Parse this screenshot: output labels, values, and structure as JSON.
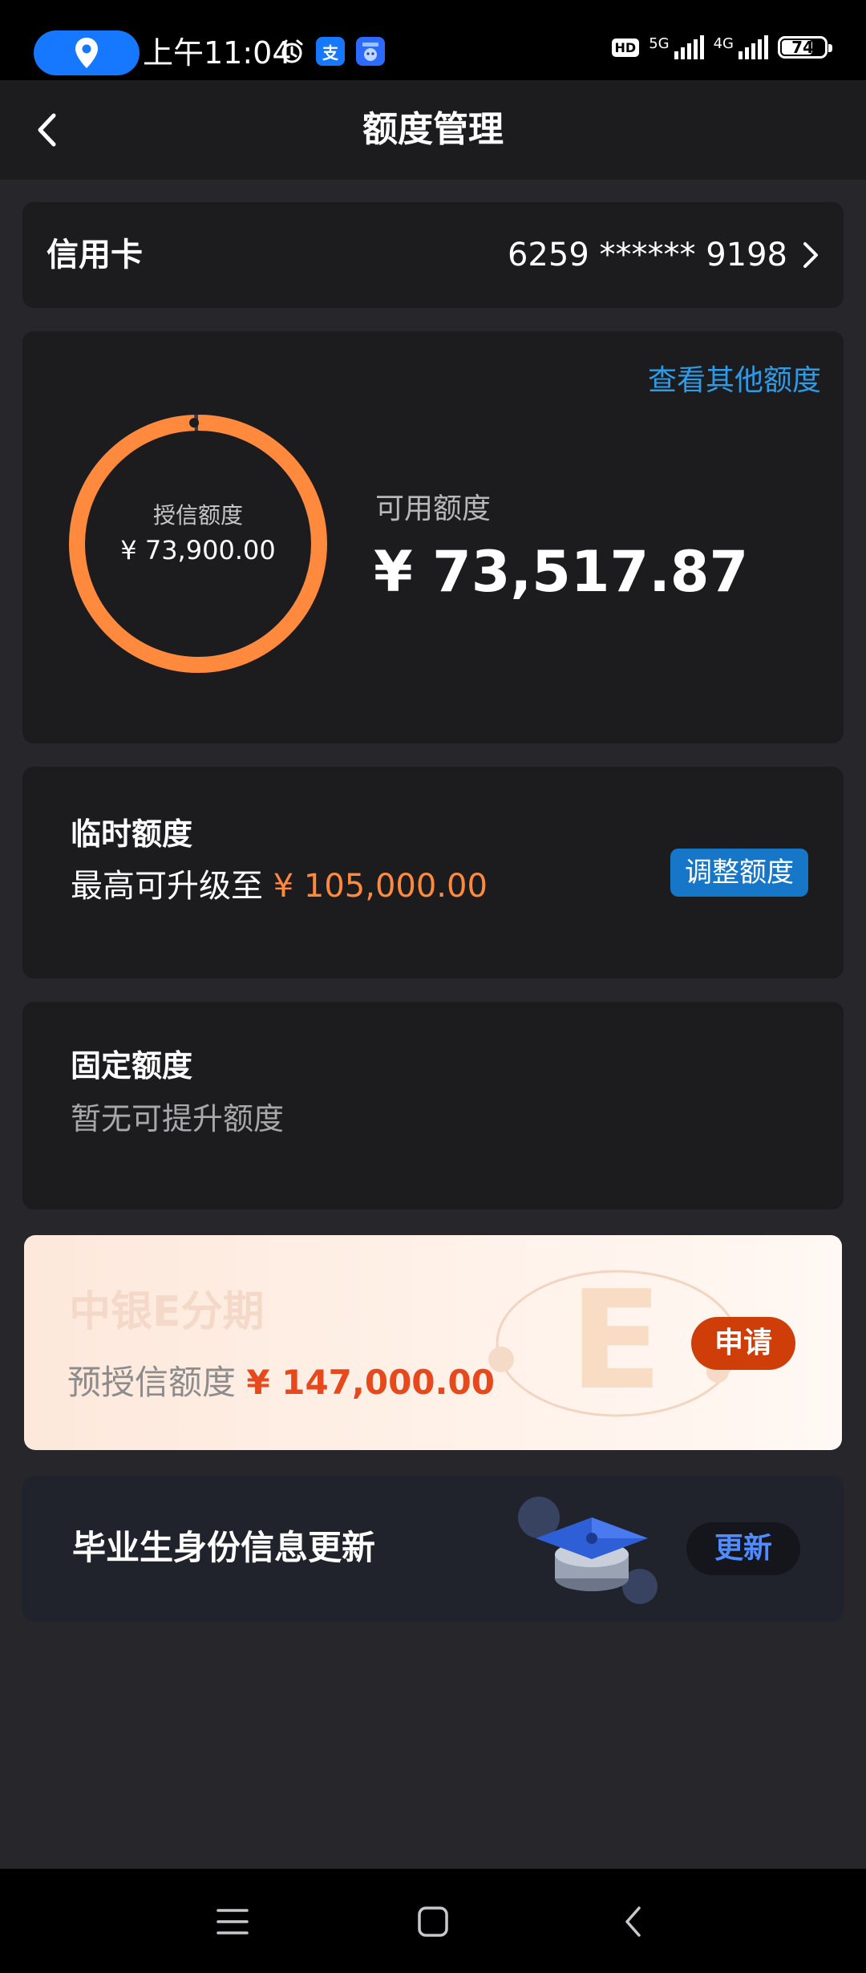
{
  "status_bar": {
    "time": "上午11:04",
    "alipay_icon_text": "支",
    "network_1": "5G",
    "network_2": "4G",
    "hd": "HD",
    "battery_level": 74,
    "battery_text": "74"
  },
  "header": {
    "title": "额度管理"
  },
  "account": {
    "label": "信用卡",
    "card_number": "6259 ****** 9198"
  },
  "credit": {
    "view_other_link": "查看其他额度",
    "total_label": "授信额度",
    "total_value": "¥ 73,900.00",
    "available_label": "可用额度",
    "available_value": "¥ 73,517.87",
    "available_fraction": 0.9948
  },
  "temporary": {
    "title": "临时额度",
    "subtitle_prefix": "最高可升级至",
    "subtitle_amount": "¥ 105,000.00",
    "button_label": "调整额度"
  },
  "fixed": {
    "title": "固定额度",
    "subtitle": "暂无可提升额度"
  },
  "promo": {
    "title": "中银E分期",
    "subtitle_prefix": "预授信额度",
    "subtitle_amount": "¥ 147,000.00",
    "button_label": "申请"
  },
  "graduate": {
    "title": "毕业生身份信息更新",
    "button_label": "更新"
  },
  "colors": {
    "ring": "#ff8a3d",
    "link": "#2e9be6",
    "adjust_button": "#1677c9",
    "apply_button": "#cf3e08",
    "update_text": "#4f8cff"
  }
}
